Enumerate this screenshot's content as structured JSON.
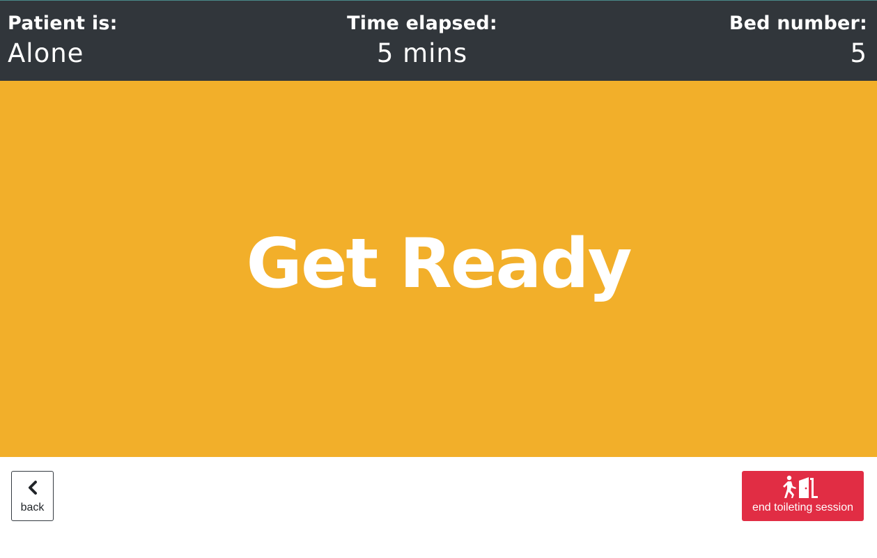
{
  "header": {
    "patient_label": "Patient is:",
    "patient_value": "Alone",
    "time_label": "Time elapsed:",
    "time_value": "5 mins",
    "bed_label": "Bed number:",
    "bed_value": "5",
    "background_color": "#31363b"
  },
  "main": {
    "status_text": "Get Ready",
    "background_color": "#f2af2a"
  },
  "footer": {
    "back_label": "back",
    "back_icon": "chevron-left-icon",
    "end_label": "end toileting session",
    "end_icon": "exit-door-icon",
    "end_color": "#e12d44"
  }
}
